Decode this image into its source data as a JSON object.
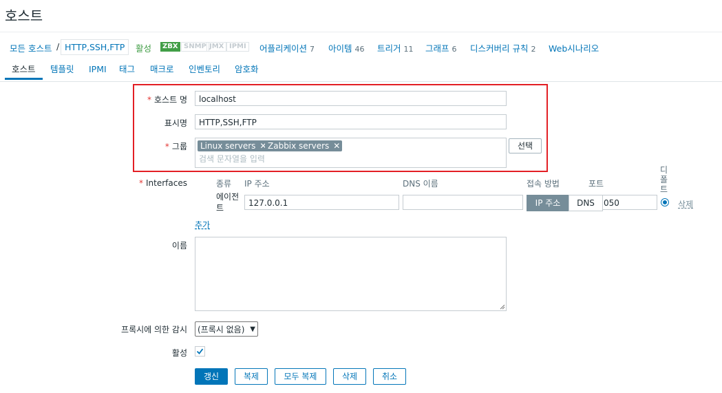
{
  "page": {
    "title": "호스트"
  },
  "breadcrumb": {
    "all_hosts": "모든 호스트",
    "separator": "/",
    "current_host": "HTTP,SSH,FTP",
    "status": "활성",
    "availability": [
      "ZBX",
      "SNMP",
      "JMX",
      "IPMI"
    ],
    "links": [
      {
        "label": "어플리케이션",
        "count": "7"
      },
      {
        "label": "아이템",
        "count": "46"
      },
      {
        "label": "트리거",
        "count": "11"
      },
      {
        "label": "그래프",
        "count": "6"
      },
      {
        "label": "디스커버리 규칙",
        "count": "2"
      },
      {
        "label": "Web시나리오",
        "count": ""
      }
    ]
  },
  "tabs": [
    "호스트",
    "템플릿",
    "IPMI",
    "태그",
    "매크로",
    "인벤토리",
    "암호화"
  ],
  "form": {
    "hostname_label": "호스트 명",
    "hostname_value": "localhost",
    "visible_name_label": "표시명",
    "visible_name_value": "HTTP,SSH,FTP",
    "groups_label": "그룹",
    "groups": [
      "Linux servers",
      "Zabbix servers"
    ],
    "groups_placeholder": "검색 문자열을 입력",
    "select_button": "선택",
    "interfaces_label": "Interfaces",
    "interface_headers": {
      "type": "종류",
      "ip": "IP 주소",
      "dns": "DNS 이름",
      "connect": "접속 방법",
      "port": "포트",
      "default": "디폴트"
    },
    "interface_row": {
      "type": "에이전트",
      "ip": "127.0.0.1",
      "dns": "",
      "connect_ip": "IP 주소",
      "connect_dns": "DNS",
      "port": "050",
      "remove": "삭제"
    },
    "add_link": "추가",
    "description_label": "이름",
    "proxy_label": "프록시에 의한 감시",
    "proxy_value": "(프록시 없음)",
    "enabled_label": "활성",
    "enabled_checked": true
  },
  "buttons": {
    "update": "갱신",
    "clone": "복제",
    "full_clone": "모두 복제",
    "delete": "삭제",
    "cancel": "취소"
  },
  "colors": {
    "accent": "#0275b8",
    "required": "#e33734",
    "highlight_box": "#e31e24",
    "zbx_green": "#429e47"
  }
}
